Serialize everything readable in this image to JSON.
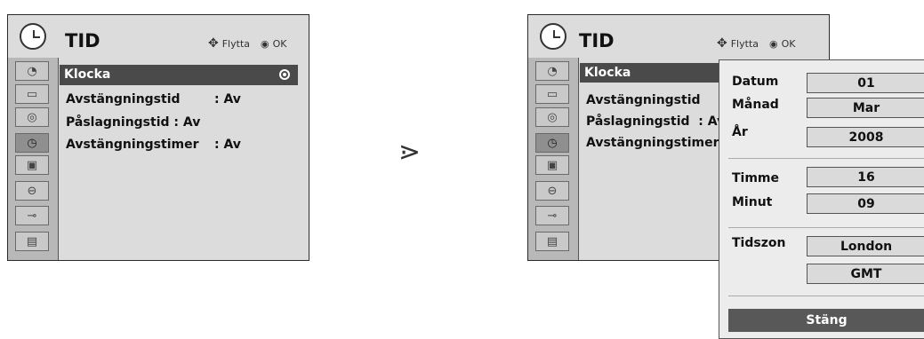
{
  "menu_title": "TID",
  "hint": {
    "move": "Flytta",
    "ok": "OK"
  },
  "sidebar_icons": [
    "satellite-icon",
    "tv-icon",
    "speaker-icon",
    "clock-icon",
    "lock-box-icon",
    "padlock-icon",
    "cable-icon",
    "clapperboard-icon"
  ],
  "left_menu": {
    "selected": "Klocka",
    "items": [
      {
        "label": "Avstängningstid",
        "value": ": Av"
      },
      {
        "label": "Påslagningstid : Av",
        "value": ""
      },
      {
        "label": "Avstängningstimer",
        "value": ": Av"
      }
    ]
  },
  "arrow": "⋗",
  "right_menu": {
    "selected": "Klocka",
    "items": [
      {
        "label": "Avstängningstid"
      },
      {
        "label": "Påslagningstid  : Av"
      },
      {
        "label": "Avstängningstimer"
      }
    ]
  },
  "clock_popup": {
    "date_label": "Datum",
    "date_value": "01",
    "month_label": "Månad",
    "month_value": "Mar",
    "year_label": "År",
    "year_value": "2008",
    "hour_label": "Timme",
    "hour_value": "16",
    "minute_label": "Minut",
    "minute_value": "09",
    "timezone_label": "Tidszon",
    "timezone_city": "London",
    "timezone_code": "GMT",
    "close_label": "Stäng"
  }
}
